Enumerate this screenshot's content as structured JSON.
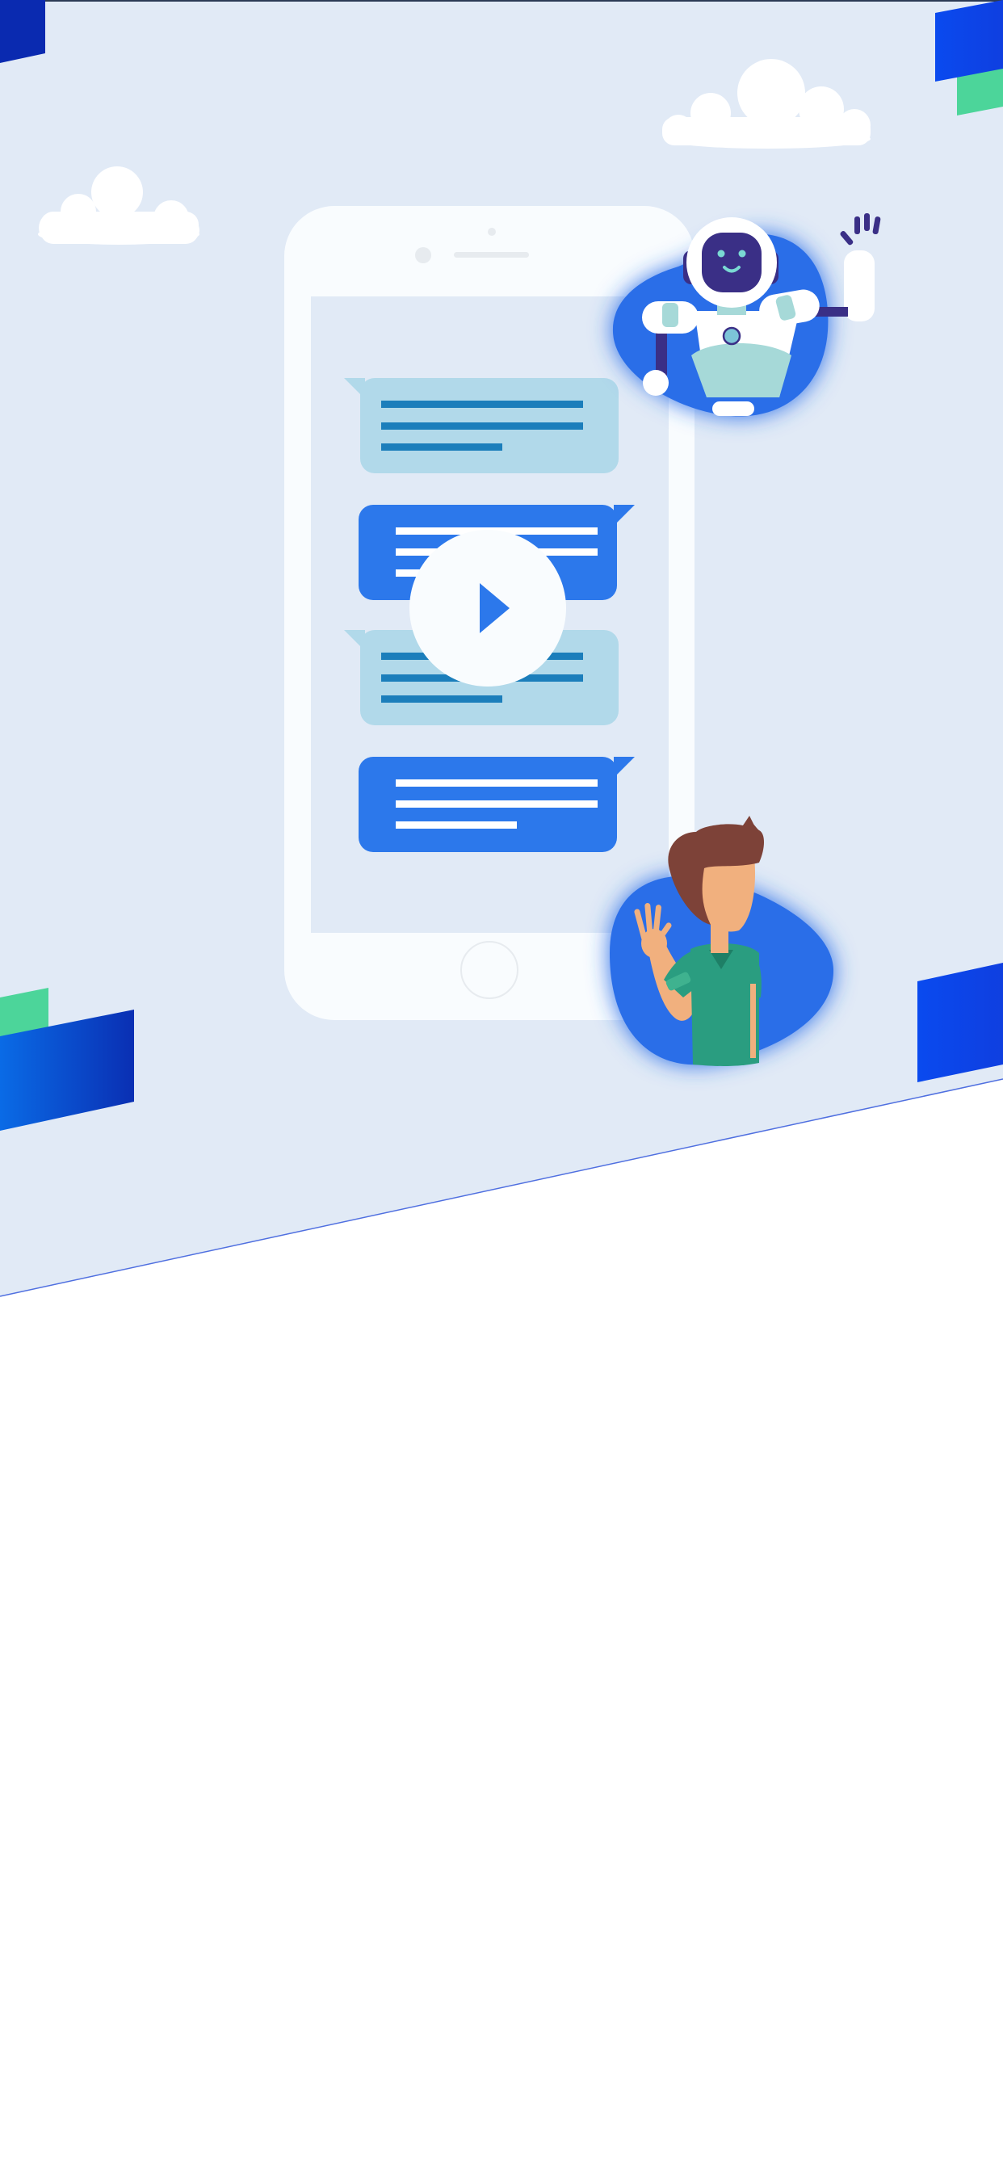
{
  "hero": {
    "illustration": "chatbot-conversation-illustration",
    "play_icon": "play-icon",
    "robot_icon": "robot-avatar-icon",
    "person_icon": "waving-person-avatar-icon"
  },
  "colors": {
    "hero_background": "#e1eaf6",
    "page_background": "#ffffff",
    "phone_body": "#f9fcfe",
    "phone_screen": "#e1eaf6",
    "bot_bubble": "#b1d9ea",
    "bot_lines": "#1b7ebb",
    "user_bubble": "#2c78eb",
    "avatar_blob": "#2a6ee8",
    "accent_blue": "#0a4aef",
    "accent_green": "#4cd59a",
    "robot_face": "#3a2f86",
    "person_shirt": "#2a9d80",
    "person_hair": "#7d4238",
    "person_skin": "#f1b07e"
  }
}
